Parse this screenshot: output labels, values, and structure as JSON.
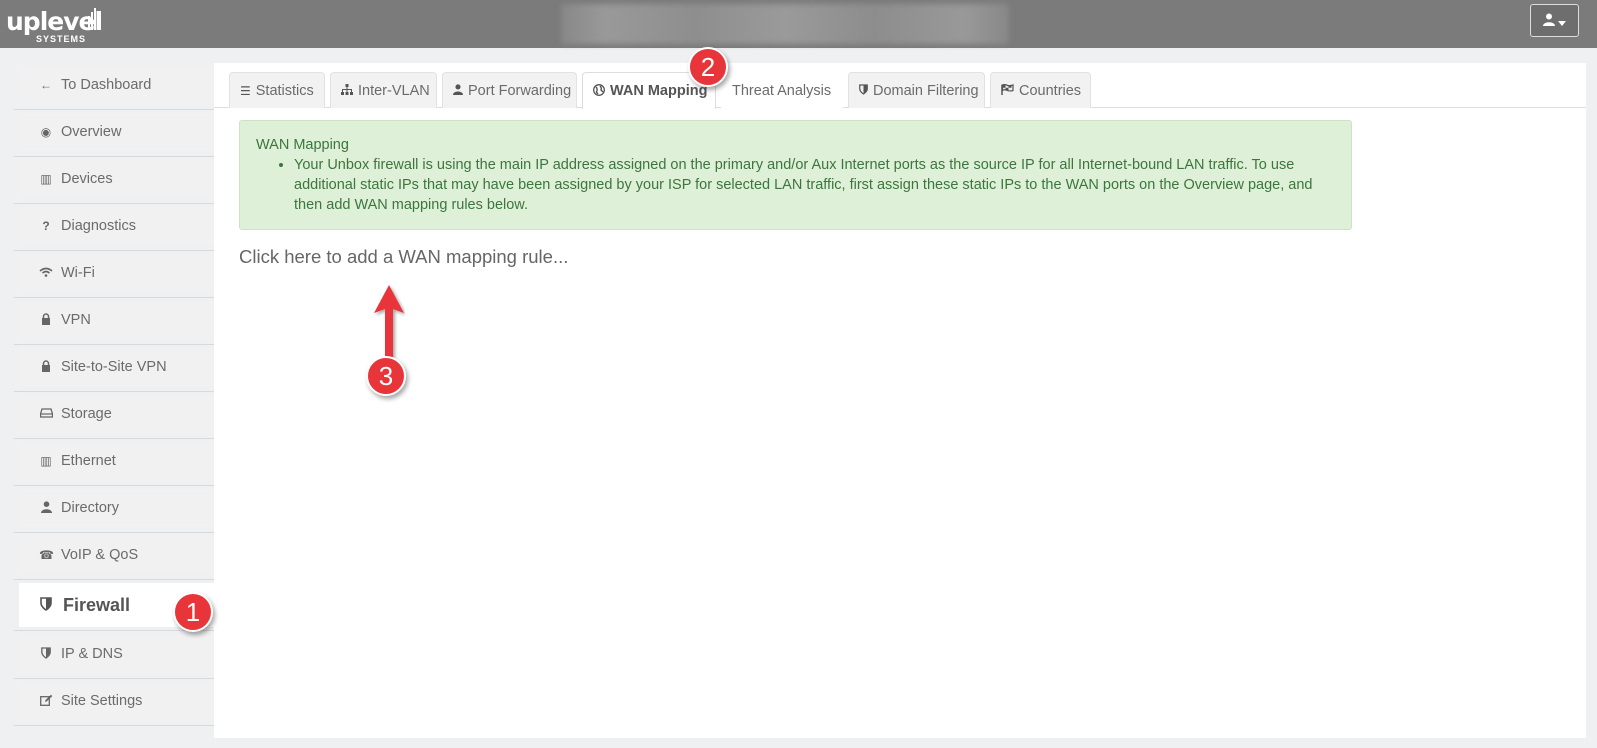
{
  "header": {
    "logo": {
      "word": "uplevel",
      "sub": "SYSTEMS"
    },
    "user_button": {
      "icon": "user-icon",
      "caret": "caret-down-icon"
    }
  },
  "sidebar": {
    "items": [
      {
        "label": "To Dashboard",
        "icon": "arrow-left-icon"
      },
      {
        "label": "Overview",
        "icon": "eye-icon"
      },
      {
        "label": "Devices",
        "icon": "building-icon"
      },
      {
        "label": "Diagnostics",
        "icon": "question-icon"
      },
      {
        "label": "Wi-Fi",
        "icon": "wifi-icon"
      },
      {
        "label": "VPN",
        "icon": "lock-icon"
      },
      {
        "label": "Site-to-Site VPN",
        "icon": "lock-icon"
      },
      {
        "label": "Storage",
        "icon": "hdd-icon"
      },
      {
        "label": "Ethernet",
        "icon": "building-icon"
      },
      {
        "label": "Directory",
        "icon": "user-icon"
      },
      {
        "label": "VoIP & QoS",
        "icon": "phone-icon"
      },
      {
        "label": "Firewall",
        "icon": "shield-icon",
        "active": true
      },
      {
        "label": "IP & DNS",
        "icon": "shield-icon"
      },
      {
        "label": "Site Settings",
        "icon": "edit-icon"
      }
    ]
  },
  "tabs": [
    {
      "label": "Statistics",
      "icon": "list-icon"
    },
    {
      "label": "Inter-VLAN",
      "icon": "sitemap-icon"
    },
    {
      "label": "Port Forwarding",
      "icon": "user-icon"
    },
    {
      "label": "WAN Mapping",
      "icon": "globe-icon",
      "active": true
    },
    {
      "label": "Threat Analysis"
    },
    {
      "label": "Domain Filtering",
      "icon": "shield-icon"
    },
    {
      "label": "Countries",
      "icon": "flag-icon"
    }
  ],
  "alert": {
    "title": "WAN Mapping",
    "bullet": "Your Unbox firewall is using the main IP address assigned on the primary and/or Aux Internet ports as the source IP for all Internet-bound LAN traffic. To use additional static IPs that may have been assigned by your ISP for selected LAN traffic, first assign these static IPs to the WAN ports on the Overview page, and then add WAN mapping rules below.",
    "bullet_lines": [
      "Your Unbox firewall is using the main IP address assigned on the primary and/or Aux Internet ports as the source IP for all Internet-bound LAN traffic. To use",
      "additional static IPs that may have been assigned by your ISP for selected LAN traffic, first assign these static IPs to the WAN ports on the Overview page, and",
      "then add WAN mapping rules below."
    ]
  },
  "add_rule_link": "Click here to add a WAN mapping rule...",
  "annotations": [
    {
      "number": "1"
    },
    {
      "number": "2"
    },
    {
      "number": "3"
    }
  ],
  "colors": {
    "topbar": "#7b7b7b",
    "alert_bg": "#dff0d8",
    "alert_text": "#3c763d",
    "badge": "#e8353a"
  }
}
